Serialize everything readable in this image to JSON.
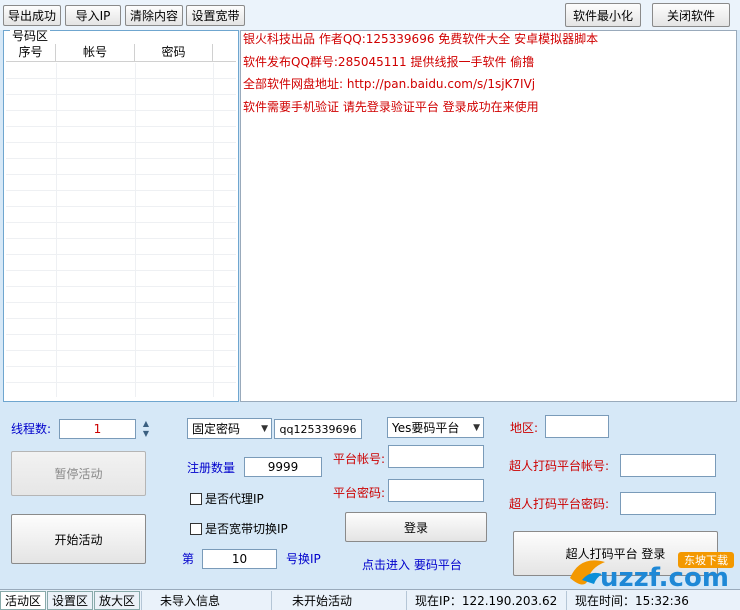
{
  "toolbar": {
    "export_success": "导出成功",
    "import_ip": "导入IP",
    "clear_content": "清除内容",
    "set_broadband": "设置宽带",
    "minimize": "软件最小化",
    "close": "关闭软件"
  },
  "number_area": {
    "title": "号码区",
    "columns": [
      "序号",
      "帐号",
      "密码"
    ]
  },
  "log_lines": [
    "银火科技出品  作者QQ:125339696 免费软件大全 安卓模拟器脚本",
    "软件发布QQ群号:285045111  提供线报一手软件 偷撸",
    "全部软件网盘地址: http://pan.baidu.com/s/1sjK7IVj",
    "软件需要手机验证 请先登录验证平台 登录成功在来使用"
  ],
  "controls": {
    "threads_label": "线程数:",
    "threads_value": "1",
    "pause_button": "暂停活动",
    "start_button": "开始活动",
    "password_mode": "固定密码",
    "password_value": "qq125339696",
    "register_count_label": "注册数量",
    "register_count_value": "9999",
    "proxy_checkbox_label": "是否代理IP",
    "broadband_checkbox_label": "是否宽带切换IP",
    "switch_prefix": "第",
    "switch_value": "10",
    "switch_suffix": "号换IP",
    "platform_select": "Yes要码平台",
    "platform_account_label": "平台帐号:",
    "platform_password_label": "平台密码:",
    "login_button": "登录",
    "enter_platform_link": "点击进入 要码平台",
    "region_label": "地区:",
    "captcha_account_label": "超人打码平台帐号:",
    "captcha_password_label": "超人打码平台密码:",
    "captcha_login_button": "超人打码平台  登录"
  },
  "status": {
    "tabs": [
      "活动区",
      "设置区",
      "放大区"
    ],
    "import_info": "未导入信息",
    "activity_status": "未开始活动",
    "current_ip": "现在IP：122.190.203.62",
    "current_time": "现在时间：15:32:36"
  },
  "watermark": {
    "text": "uzzf.com",
    "subtext": "东坡下载"
  }
}
